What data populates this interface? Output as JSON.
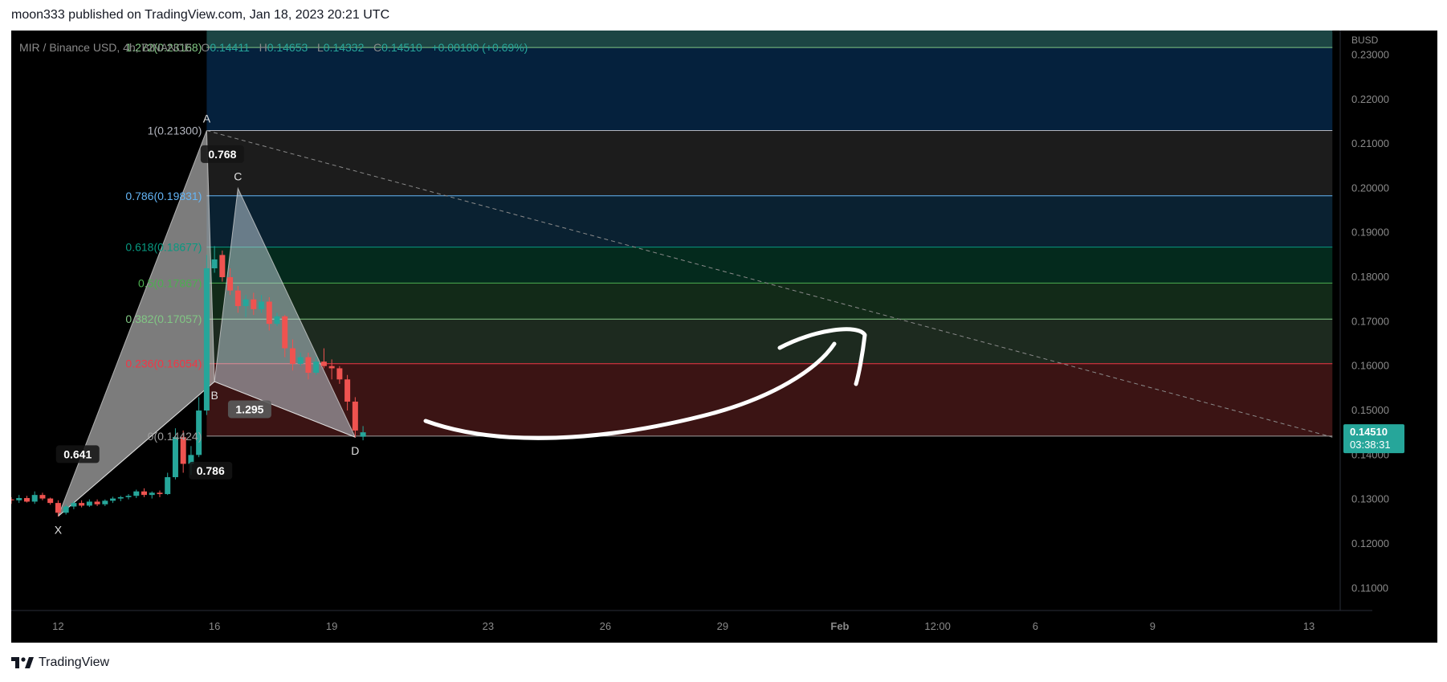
{
  "header": {
    "publisher_line": "moon333 published on TradingView.com, Jan 18, 2023 20:21 UTC"
  },
  "footer": {
    "brand": "TradingView",
    "logo_icon": "tradingview-logo-icon"
  },
  "legend": {
    "symbol": "MIR / Binance USD, 4h, BINANCE",
    "o_label": "O",
    "o": "0.14411",
    "h_label": "H",
    "h": "0.14653",
    "l_label": "L",
    "l": "0.14332",
    "c_label": "C",
    "c": "0.14510",
    "change": "+0.00100 (+0.69%)"
  },
  "colors": {
    "up": "#26a69a",
    "down": "#ef5350",
    "background": "#000000"
  },
  "chart_data": {
    "type": "candlestick",
    "price_axis": {
      "unit": "BUSD",
      "min": 0.105,
      "max": 0.2355,
      "ticks": [
        0.11,
        0.12,
        0.13,
        0.14,
        0.15,
        0.16,
        0.17,
        0.18,
        0.19,
        0.2,
        0.21,
        0.22,
        0.23
      ],
      "tick_labels": [
        "0.11000",
        "0.12000",
        "0.13000",
        "0.14000",
        "0.15000",
        "0.16000",
        "0.17000",
        "0.18000",
        "0.19000",
        "0.20000",
        "0.21000",
        "0.22000",
        "0.23000"
      ]
    },
    "time_axis": {
      "x_min": 10.8,
      "x_max": 44.8,
      "ticks": [
        {
          "x": 12,
          "label": "12"
        },
        {
          "x": 16,
          "label": "16"
        },
        {
          "x": 19,
          "label": "19"
        },
        {
          "x": 23,
          "label": "23"
        },
        {
          "x": 26,
          "label": "26"
        },
        {
          "x": 29,
          "label": "29"
        },
        {
          "x": 32,
          "label": "Feb",
          "bold": true
        },
        {
          "x": 34.5,
          "label": "12:00"
        },
        {
          "x": 37,
          "label": "6"
        },
        {
          "x": 40,
          "label": "9"
        },
        {
          "x": 44,
          "label": "13"
        }
      ]
    },
    "current_price": {
      "price": "0.14510",
      "countdown": "03:38:31",
      "value": 0.1451
    },
    "candles": [
      [
        10.8,
        0.13,
        0.1305,
        0.129,
        0.1298
      ],
      [
        11.0,
        0.1298,
        0.131,
        0.1292,
        0.1303
      ],
      [
        11.2,
        0.1303,
        0.1308,
        0.1293,
        0.1295
      ],
      [
        11.4,
        0.1295,
        0.1318,
        0.129,
        0.131
      ],
      [
        11.6,
        0.131,
        0.1315,
        0.1298,
        0.1302
      ],
      [
        11.8,
        0.1302,
        0.1304,
        0.1288,
        0.1292
      ],
      [
        12.0,
        0.1292,
        0.1298,
        0.1262,
        0.127
      ],
      [
        12.2,
        0.127,
        0.1288,
        0.1266,
        0.1284
      ],
      [
        12.4,
        0.1284,
        0.1296,
        0.1278,
        0.1292
      ],
      [
        12.6,
        0.1292,
        0.1298,
        0.1282,
        0.1286
      ],
      [
        12.8,
        0.1286,
        0.13,
        0.1283,
        0.1295
      ],
      [
        13.0,
        0.1295,
        0.13,
        0.1285,
        0.1289
      ],
      [
        13.2,
        0.1289,
        0.13,
        0.1285,
        0.1297
      ],
      [
        13.4,
        0.1297,
        0.1306,
        0.1292,
        0.1302
      ],
      [
        13.6,
        0.1302,
        0.1308,
        0.1296,
        0.1305
      ],
      [
        13.8,
        0.1305,
        0.1312,
        0.13,
        0.1308
      ],
      [
        14.0,
        0.1308,
        0.1322,
        0.1303,
        0.1318
      ],
      [
        14.2,
        0.1318,
        0.1325,
        0.1305,
        0.131
      ],
      [
        14.4,
        0.131,
        0.1318,
        0.1302,
        0.1315
      ],
      [
        14.6,
        0.1315,
        0.132,
        0.1305,
        0.1312
      ],
      [
        14.8,
        0.1312,
        0.136,
        0.131,
        0.135
      ],
      [
        15.0,
        0.135,
        0.146,
        0.1345,
        0.144
      ],
      [
        15.2,
        0.144,
        0.1455,
        0.136,
        0.138
      ],
      [
        15.4,
        0.138,
        0.142,
        0.1355,
        0.14
      ],
      [
        15.6,
        0.14,
        0.153,
        0.1395,
        0.15
      ],
      [
        15.8,
        0.15,
        0.185,
        0.149,
        0.182
      ],
      [
        16.0,
        0.182,
        0.187,
        0.181,
        0.184
      ],
      [
        16.2,
        0.185,
        0.186,
        0.179,
        0.18
      ],
      [
        16.4,
        0.18,
        0.182,
        0.176,
        0.177
      ],
      [
        16.6,
        0.177,
        0.178,
        0.172,
        0.1735
      ],
      [
        16.8,
        0.1735,
        0.176,
        0.171,
        0.175
      ],
      [
        17.0,
        0.175,
        0.1765,
        0.1715,
        0.1728
      ],
      [
        17.2,
        0.1728,
        0.176,
        0.172,
        0.1745
      ],
      [
        17.4,
        0.1745,
        0.1755,
        0.168,
        0.1695
      ],
      [
        17.6,
        0.1695,
        0.172,
        0.169,
        0.1712
      ],
      [
        17.8,
        0.1712,
        0.1715,
        0.162,
        0.164
      ],
      [
        18.0,
        0.164,
        0.166,
        0.159,
        0.1605
      ],
      [
        18.2,
        0.1605,
        0.163,
        0.16,
        0.162
      ],
      [
        18.4,
        0.162,
        0.163,
        0.157,
        0.1585
      ],
      [
        18.6,
        0.1585,
        0.162,
        0.158,
        0.161
      ],
      [
        18.8,
        0.161,
        0.164,
        0.1595,
        0.16
      ],
      [
        19.0,
        0.16,
        0.1615,
        0.157,
        0.1595
      ],
      [
        19.2,
        0.1595,
        0.16,
        0.156,
        0.157
      ],
      [
        19.4,
        0.157,
        0.158,
        0.15,
        0.152
      ],
      [
        19.6,
        0.152,
        0.153,
        0.144,
        0.1455
      ],
      [
        19.8,
        0.1441,
        0.1465,
        0.1433,
        0.1451
      ]
    ],
    "fib_levels": [
      {
        "ratio_label": "0",
        "price_label": "0.14424",
        "value": 0.14424,
        "color": "#9e9e9e",
        "fill": "#3b1414"
      },
      {
        "ratio_label": "0.236",
        "price_label": "0.16054",
        "value": 0.16054,
        "color": "#f23645",
        "fill": "#1d2a1f"
      },
      {
        "ratio_label": "0.382",
        "price_label": "0.17057",
        "value": 0.17057,
        "color": "#81c784",
        "fill": "#122a18"
      },
      {
        "ratio_label": "0.5",
        "price_label": "0.17867",
        "value": 0.17867,
        "color": "#4caf50",
        "fill": "#042a1d"
      },
      {
        "ratio_label": "0.618",
        "price_label": "0.18677",
        "value": 0.18677,
        "color": "#089981",
        "fill": "#0a2131"
      },
      {
        "ratio_label": "0.786",
        "price_label": "0.19831",
        "value": 0.19831,
        "color": "#64b5f6",
        "fill": "#1c1c1c"
      },
      {
        "ratio_label": "1",
        "price_label": "0.21300",
        "value": 0.213,
        "color": "#b2b5be",
        "fill": "#05213d"
      },
      {
        "ratio_label": "1.272",
        "price_label": "0.23168",
        "value": 0.23168,
        "color": "#81c784",
        "fill": "#1c4544"
      }
    ],
    "fib_x_start": 15.8,
    "fib_x_end": 44.6,
    "harmonic_pattern": {
      "points": [
        {
          "label": "X",
          "x": 12.0,
          "y": 0.1262
        },
        {
          "label": "A",
          "x": 15.8,
          "y": 0.213
        },
        {
          "label": "B",
          "x": 16.0,
          "y": 0.1565
        },
        {
          "label": "C",
          "x": 16.6,
          "y": 0.2
        },
        {
          "label": "D",
          "x": 19.6,
          "y": 0.144
        }
      ],
      "ratios": [
        {
          "label": "0.768",
          "x": 16.2,
          "y": 0.2075
        },
        {
          "label": "0.641",
          "x": 12.5,
          "y": 0.14
        },
        {
          "label": "0.786",
          "x": 15.9,
          "y": 0.1363
        },
        {
          "label": "1.295",
          "x": 16.9,
          "y": 0.1501
        }
      ]
    },
    "trendline": {
      "from": [
        15.8,
        0.213
      ],
      "to": [
        44.6,
        0.144
      ]
    }
  }
}
